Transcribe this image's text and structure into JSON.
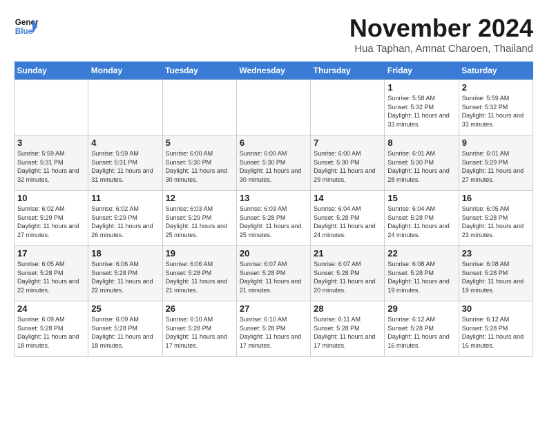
{
  "header": {
    "logo_line1": "General",
    "logo_line2": "Blue",
    "month": "November 2024",
    "location": "Hua Taphan, Amnat Charoen, Thailand"
  },
  "days_of_week": [
    "Sunday",
    "Monday",
    "Tuesday",
    "Wednesday",
    "Thursday",
    "Friday",
    "Saturday"
  ],
  "weeks": [
    [
      {
        "num": "",
        "info": ""
      },
      {
        "num": "",
        "info": ""
      },
      {
        "num": "",
        "info": ""
      },
      {
        "num": "",
        "info": ""
      },
      {
        "num": "",
        "info": ""
      },
      {
        "num": "1",
        "info": "Sunrise: 5:58 AM\nSunset: 5:32 PM\nDaylight: 11 hours\nand 33 minutes."
      },
      {
        "num": "2",
        "info": "Sunrise: 5:59 AM\nSunset: 5:32 PM\nDaylight: 11 hours\nand 33 minutes."
      }
    ],
    [
      {
        "num": "3",
        "info": "Sunrise: 5:59 AM\nSunset: 5:31 PM\nDaylight: 11 hours\nand 32 minutes."
      },
      {
        "num": "4",
        "info": "Sunrise: 5:59 AM\nSunset: 5:31 PM\nDaylight: 11 hours\nand 31 minutes."
      },
      {
        "num": "5",
        "info": "Sunrise: 6:00 AM\nSunset: 5:30 PM\nDaylight: 11 hours\nand 30 minutes."
      },
      {
        "num": "6",
        "info": "Sunrise: 6:00 AM\nSunset: 5:30 PM\nDaylight: 11 hours\nand 30 minutes."
      },
      {
        "num": "7",
        "info": "Sunrise: 6:00 AM\nSunset: 5:30 PM\nDaylight: 11 hours\nand 29 minutes."
      },
      {
        "num": "8",
        "info": "Sunrise: 6:01 AM\nSunset: 5:30 PM\nDaylight: 11 hours\nand 28 minutes."
      },
      {
        "num": "9",
        "info": "Sunrise: 6:01 AM\nSunset: 5:29 PM\nDaylight: 11 hours\nand 27 minutes."
      }
    ],
    [
      {
        "num": "10",
        "info": "Sunrise: 6:02 AM\nSunset: 5:29 PM\nDaylight: 11 hours\nand 27 minutes."
      },
      {
        "num": "11",
        "info": "Sunrise: 6:02 AM\nSunset: 5:29 PM\nDaylight: 11 hours\nand 26 minutes."
      },
      {
        "num": "12",
        "info": "Sunrise: 6:03 AM\nSunset: 5:29 PM\nDaylight: 11 hours\nand 25 minutes."
      },
      {
        "num": "13",
        "info": "Sunrise: 6:03 AM\nSunset: 5:28 PM\nDaylight: 11 hours\nand 25 minutes."
      },
      {
        "num": "14",
        "info": "Sunrise: 6:04 AM\nSunset: 5:28 PM\nDaylight: 11 hours\nand 24 minutes."
      },
      {
        "num": "15",
        "info": "Sunrise: 6:04 AM\nSunset: 5:28 PM\nDaylight: 11 hours\nand 24 minutes."
      },
      {
        "num": "16",
        "info": "Sunrise: 6:05 AM\nSunset: 5:28 PM\nDaylight: 11 hours\nand 23 minutes."
      }
    ],
    [
      {
        "num": "17",
        "info": "Sunrise: 6:05 AM\nSunset: 5:28 PM\nDaylight: 11 hours\nand 22 minutes."
      },
      {
        "num": "18",
        "info": "Sunrise: 6:06 AM\nSunset: 5:28 PM\nDaylight: 11 hours\nand 22 minutes."
      },
      {
        "num": "19",
        "info": "Sunrise: 6:06 AM\nSunset: 5:28 PM\nDaylight: 11 hours\nand 21 minutes."
      },
      {
        "num": "20",
        "info": "Sunrise: 6:07 AM\nSunset: 5:28 PM\nDaylight: 11 hours\nand 21 minutes."
      },
      {
        "num": "21",
        "info": "Sunrise: 6:07 AM\nSunset: 5:28 PM\nDaylight: 11 hours\nand 20 minutes."
      },
      {
        "num": "22",
        "info": "Sunrise: 6:08 AM\nSunset: 5:28 PM\nDaylight: 11 hours\nand 19 minutes."
      },
      {
        "num": "23",
        "info": "Sunrise: 6:08 AM\nSunset: 5:28 PM\nDaylight: 11 hours\nand 19 minutes."
      }
    ],
    [
      {
        "num": "24",
        "info": "Sunrise: 6:09 AM\nSunset: 5:28 PM\nDaylight: 11 hours\nand 18 minutes."
      },
      {
        "num": "25",
        "info": "Sunrise: 6:09 AM\nSunset: 5:28 PM\nDaylight: 11 hours\nand 18 minutes."
      },
      {
        "num": "26",
        "info": "Sunrise: 6:10 AM\nSunset: 5:28 PM\nDaylight: 11 hours\nand 17 minutes."
      },
      {
        "num": "27",
        "info": "Sunrise: 6:10 AM\nSunset: 5:28 PM\nDaylight: 11 hours\nand 17 minutes."
      },
      {
        "num": "28",
        "info": "Sunrise: 6:11 AM\nSunset: 5:28 PM\nDaylight: 11 hours\nand 17 minutes."
      },
      {
        "num": "29",
        "info": "Sunrise: 6:12 AM\nSunset: 5:28 PM\nDaylight: 11 hours\nand 16 minutes."
      },
      {
        "num": "30",
        "info": "Sunrise: 6:12 AM\nSunset: 5:28 PM\nDaylight: 11 hours\nand 16 minutes."
      }
    ]
  ]
}
